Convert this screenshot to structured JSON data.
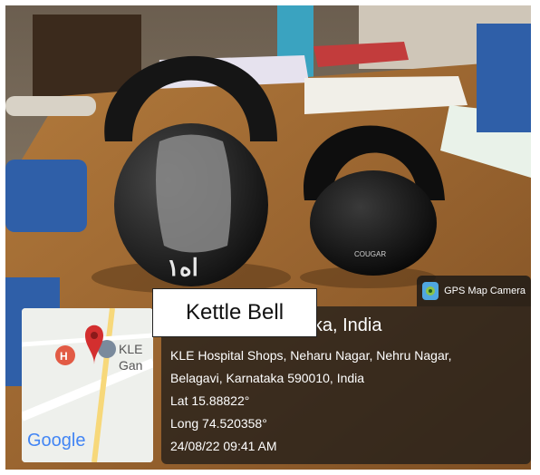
{
  "annotation": {
    "label": "Kettle Bell"
  },
  "gps_app": {
    "name": "GPS Map Camera"
  },
  "location": {
    "city_line": "Belagavi, Karnataka, India",
    "address_line1": "KLE Hospital Shops, Neharu Nagar, Nehru Nagar,",
    "address_line2": "Belagavi, Karnataka 590010, India",
    "latitude": "Lat 15.88822°",
    "longitude": "Long 74.520358°",
    "timestamp": "24/08/22 09:41 AM"
  },
  "map": {
    "brand": "Google",
    "place_label_1": "KLE",
    "place_label_2": "Gan",
    "pin_color": "#d32f2f"
  },
  "kettlebells": {
    "large_mark": "ا‌ە۱",
    "small_brand": "COUGAR"
  }
}
